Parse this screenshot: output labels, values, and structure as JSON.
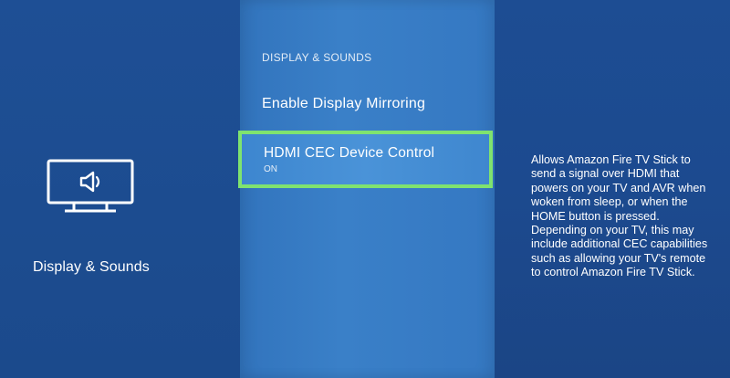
{
  "sidebar": {
    "icon": "tv-speaker-icon",
    "category_label": "Display & Sounds"
  },
  "menu": {
    "header": "DISPLAY & SOUNDS",
    "items": [
      {
        "label": "Enable Display Mirroring",
        "value": ""
      },
      {
        "label": "HDMI CEC Device Control",
        "value": "ON",
        "selected": true
      }
    ]
  },
  "description": {
    "text": "Allows Amazon Fire TV Stick to send a signal over HDMI that powers on your TV and AVR when woken from sleep, or when the HOME button is pressed. Depending on your TV, this may include additional CEC capabilities such as allowing your TV's remote to control Amazon Fire TV Stick."
  },
  "colors": {
    "background": "#1d4d93",
    "menu_panel": "#3a80c8",
    "focus_border": "#7fe36f",
    "text": "#ffffff"
  }
}
